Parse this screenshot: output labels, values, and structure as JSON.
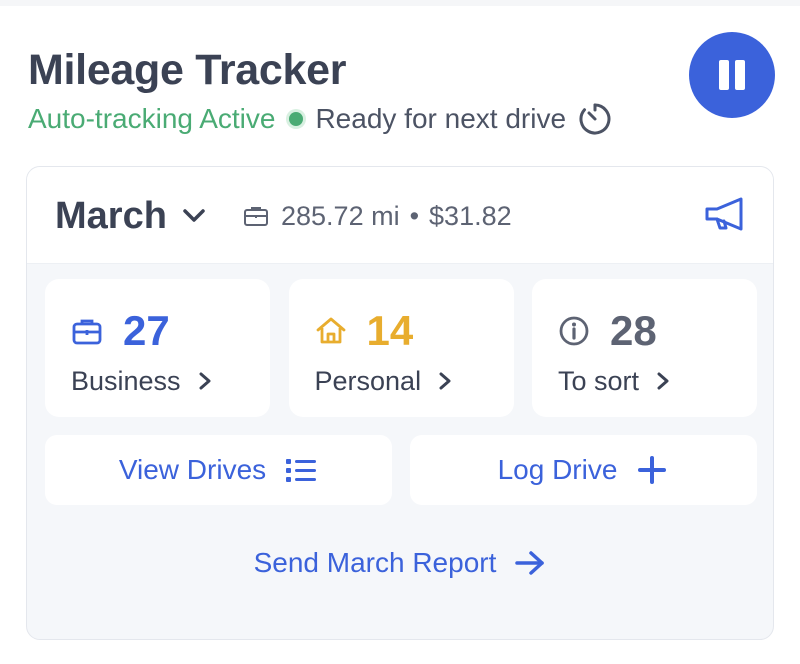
{
  "header": {
    "title": "Mileage Tracker",
    "status_active": "Auto-tracking Active",
    "status_ready": "Ready for next drive"
  },
  "month": {
    "label": "March",
    "distance": "285.72 mi",
    "separator": "•",
    "amount": "$31.82"
  },
  "tiles": [
    {
      "count": "27",
      "label": "Business",
      "icon": "briefcase-icon",
      "color": "#3b62db"
    },
    {
      "count": "14",
      "label": "Personal",
      "icon": "home-icon",
      "color": "#e8ad2e"
    },
    {
      "count": "28",
      "label": "To sort",
      "icon": "info-icon",
      "color": "#5d6373"
    }
  ],
  "actions": {
    "view_drives": "View Drives",
    "log_drive": "Log Drive"
  },
  "report": {
    "label": "Send March Report"
  },
  "colors": {
    "accent": "#3b62db",
    "active_green": "#4aab74",
    "personal_yellow": "#e8ad2e",
    "neutral": "#5d6373"
  }
}
